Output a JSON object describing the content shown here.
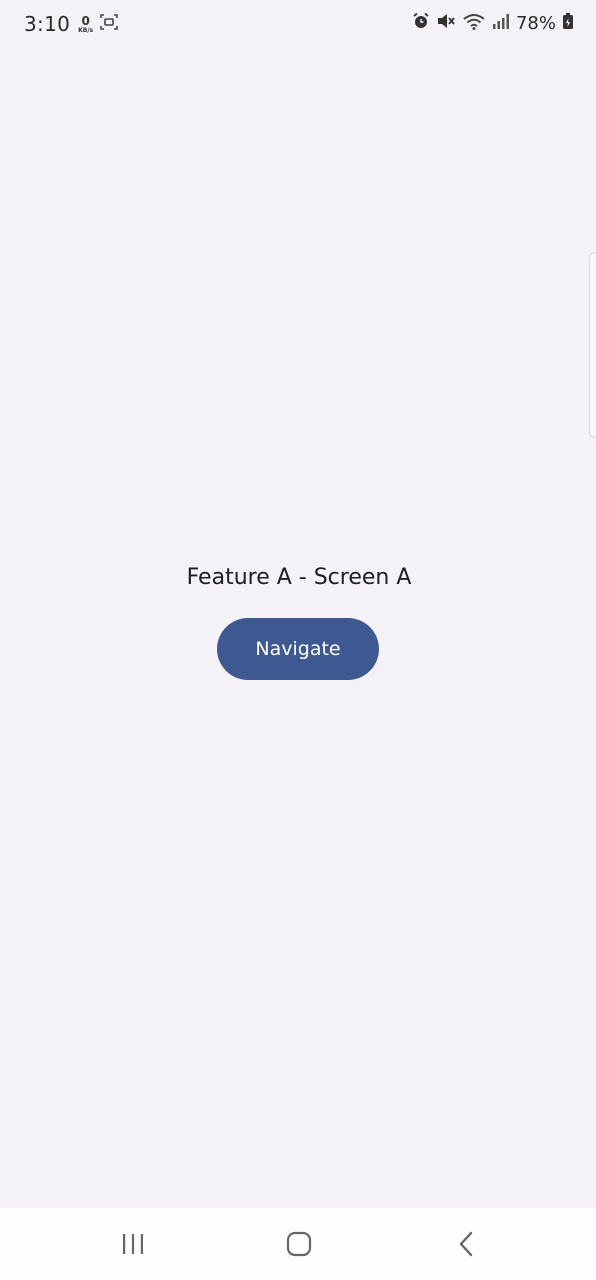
{
  "status_bar": {
    "time": "3:10",
    "speed_value": "0",
    "speed_unit": "KB/s",
    "battery_percent": "78%",
    "icons": [
      "screenshot-icon",
      "alarm-icon",
      "mute-icon",
      "wifi-icon",
      "signal-icon",
      "battery-icon"
    ]
  },
  "screen": {
    "title": "Feature A - Screen A",
    "navigate_label": "Navigate"
  },
  "colors": {
    "background": "#f4f2f7",
    "button": "#3e5891",
    "button_text": "#ffffff"
  },
  "nav_bar": {
    "icons": [
      "recent-apps-icon",
      "home-icon",
      "back-icon"
    ]
  }
}
